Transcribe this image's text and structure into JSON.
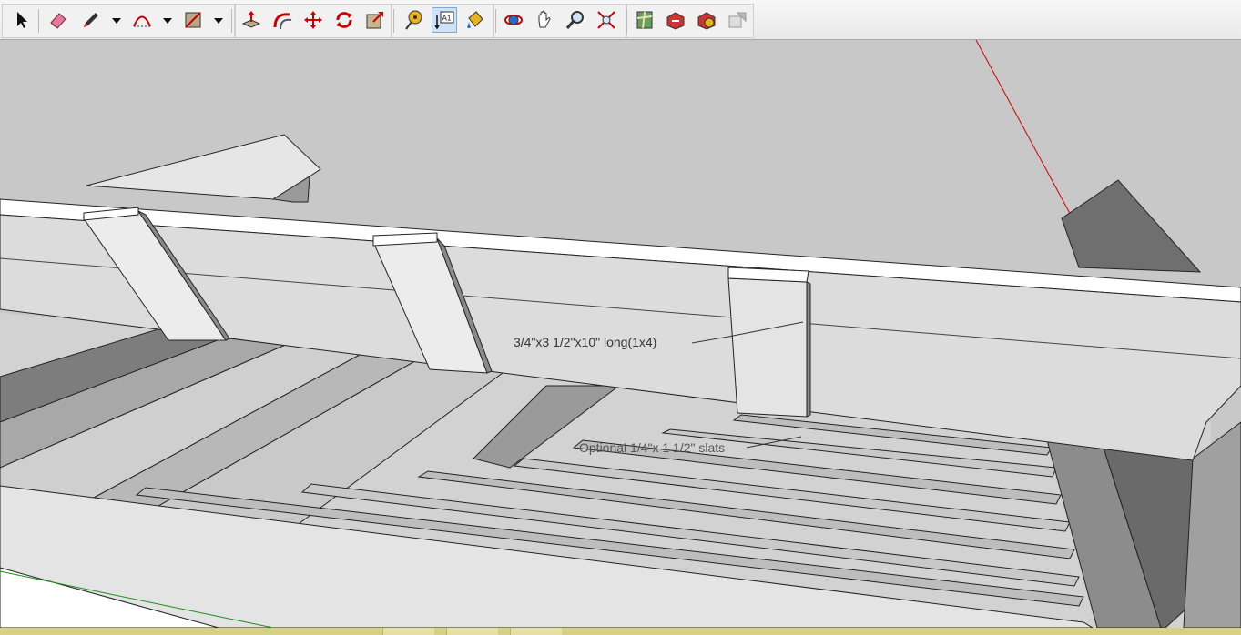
{
  "toolbar": {
    "tools": [
      {
        "name": "select-tool-icon",
        "active": false
      },
      {
        "name": "eraser-tool-icon",
        "active": false
      },
      {
        "name": "pencil-tool-icon",
        "active": false
      },
      {
        "name": "arc-tool-icon",
        "active": false
      },
      {
        "name": "rectangle-tool-icon",
        "active": false
      },
      {
        "name": "push-pull-tool-icon",
        "active": false
      },
      {
        "name": "follow-me-tool-icon",
        "active": false
      },
      {
        "name": "move-tool-icon",
        "active": false
      },
      {
        "name": "rotate-tool-icon",
        "active": false
      },
      {
        "name": "scale-tool-icon",
        "active": false
      },
      {
        "name": "tape-measure-tool-icon",
        "active": false
      },
      {
        "name": "text-tool-icon",
        "active": true
      },
      {
        "name": "paint-bucket-tool-icon",
        "active": false
      },
      {
        "name": "orbit-tool-icon",
        "active": false
      },
      {
        "name": "pan-tool-icon",
        "active": false
      },
      {
        "name": "zoom-tool-icon",
        "active": false
      },
      {
        "name": "zoom-extents-tool-icon",
        "active": false
      },
      {
        "name": "add-location-tool-icon",
        "active": false
      },
      {
        "name": "get-models-tool-icon",
        "active": false
      },
      {
        "name": "share-model-tool-icon",
        "active": false
      },
      {
        "name": "share-component-tool-icon",
        "active": false
      }
    ],
    "text_tool_glyph": "A1"
  },
  "annotations": {
    "board_label": "3/4\"x3 1/2\"x10\" long(1x4)",
    "slat_label": "Optional 1/4\"x 1 1/2\" slats"
  },
  "colors": {
    "background": "#c8c8c8",
    "red_axis": "#d00000",
    "green_axis": "#1a8f1a",
    "rail_face": "#dadada",
    "rail_top": "#ffffff",
    "taskbar": "#d5cf88"
  }
}
